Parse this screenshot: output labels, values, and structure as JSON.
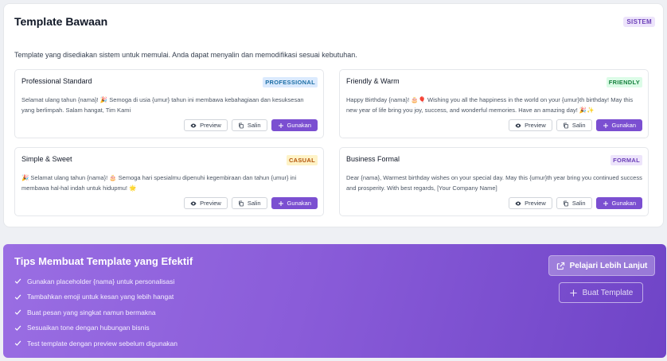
{
  "panel": {
    "title": "Template Bawaan",
    "badge": "SISTEM",
    "description": "Template yang disediakan sistem untuk memulai. Anda dapat menyalin dan memodifikasi sesuai kebutuhan."
  },
  "buttons": {
    "preview": "Preview",
    "copy": "Salin",
    "use": "Gunakan"
  },
  "templates": [
    {
      "title": "Professional Standard",
      "badge": "PROFESSIONAL",
      "badge_color": "#1d6fa5",
      "badge_bg": "#dbeafe",
      "text": "Selamat ulang tahun {nama}! 🎉 Semoga di usia {umur} tahun ini membawa kebahagiaan dan kesuksesan yang berlimpah. Salam hangat, Tim Kami"
    },
    {
      "title": "Friendly & Warm",
      "badge": "FRIENDLY",
      "badge_color": "#15803d",
      "badge_bg": "#dcfce7",
      "text": "Happy Birthday {nama}! 🎂🎈 Wishing you all the happiness in the world on your {umur}th birthday! May this new year of life bring you joy, success, and wonderful memories. Have an amazing day! 🎉✨"
    },
    {
      "title": "Simple & Sweet",
      "badge": "CASUAL",
      "badge_color": "#b45309",
      "badge_bg": "#fef3c7",
      "text": "🎉 Selamat ulang tahun {nama}! 🎂 Semoga hari spesialmu dipenuhi kegembiraan dan tahun {umur} ini membawa hal-hal indah untuk hidupmu! 🌟"
    },
    {
      "title": "Business Formal",
      "badge": "FORMAL",
      "badge_color": "#6b3fb8",
      "badge_bg": "#ede4fb",
      "text": "Dear {nama}, Warmest birthday wishes on your special day. May this {umur}th year bring you continued success and prosperity. With best regards, [Your Company Name]"
    }
  ],
  "tips": {
    "title": "Tips Membuat Template yang Efektif",
    "items": [
      "Gunakan placeholder {nama} untuk personalisasi",
      "Tambahkan emoji untuk kesan yang lebih hangat",
      "Buat pesan yang singkat namun bermakna",
      "Sesuaikan tone dengan hubungan bisnis",
      "Test template dengan preview sebelum digunakan"
    ],
    "learn_more": "Pelajari Lebih Lanjut",
    "create_template": "Buat Template"
  }
}
